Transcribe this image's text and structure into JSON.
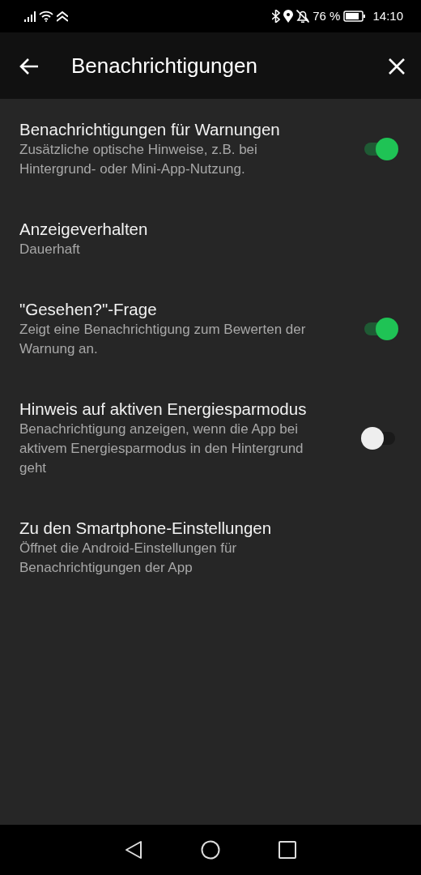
{
  "status_bar": {
    "battery": "76 %",
    "time": "14:10"
  },
  "app_bar": {
    "title": "Benachrichtigungen"
  },
  "settings": [
    {
      "kind": "toggle",
      "title": "Benachrichtigungen für Warnungen",
      "subtitle": "Zusätzliche optische Hinweise, z.B. bei Hintergrund- oder Mini-App-Nutzung.",
      "on": true
    },
    {
      "kind": "link",
      "title": "Anzeigeverhalten",
      "subtitle": "Dauerhaft"
    },
    {
      "kind": "toggle",
      "title": "\"Gesehen?\"-Frage",
      "subtitle": "Zeigt eine Benachrichtigung zum Bewerten der Warnung an.",
      "on": true
    },
    {
      "kind": "toggle",
      "title": "Hinweis auf aktiven Energiesparmodus",
      "subtitle": "Benachrichtigung anzeigen, wenn die App bei aktivem Energiesparmodus in den Hintergrund geht",
      "on": false
    },
    {
      "kind": "link",
      "title": "Zu den Smartphone-Einstellungen",
      "subtitle": "Öffnet die Android-Einstellungen für Benachrichtigungen der App"
    }
  ]
}
